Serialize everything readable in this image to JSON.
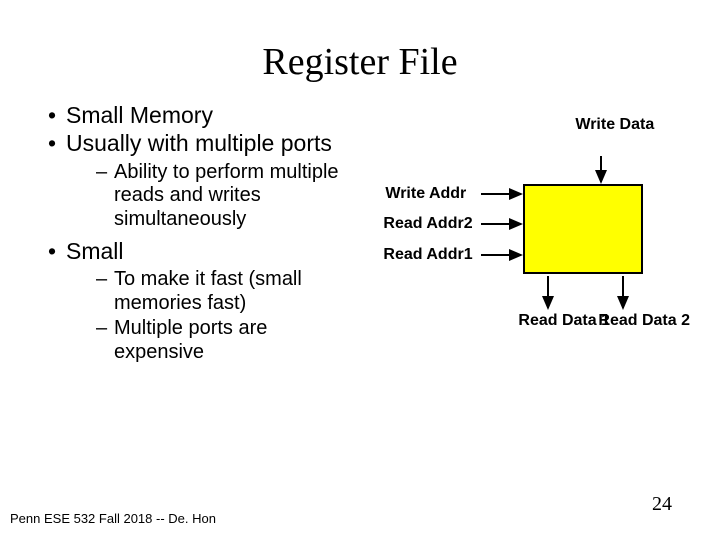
{
  "title": "Register File",
  "bullets": {
    "b1": "Small Memory",
    "b2": "Usually with multiple ports",
    "b2_1": "Ability to perform multiple reads and writes simultaneously",
    "b3": "Small",
    "b3_1": "To make it fast (small memories fast)",
    "b3_2": "Multiple ports are expensive"
  },
  "diagram": {
    "write_data": "Write Data",
    "write_addr": "Write Addr",
    "read_addr1": "Read Addr1",
    "read_addr2": "Read Addr2",
    "read_data1": "Read Data 1",
    "read_data2": "Read Data 2"
  },
  "footer": "Penn ESE 532 Fall 2018 -- De. Hon",
  "pagenum": "24"
}
